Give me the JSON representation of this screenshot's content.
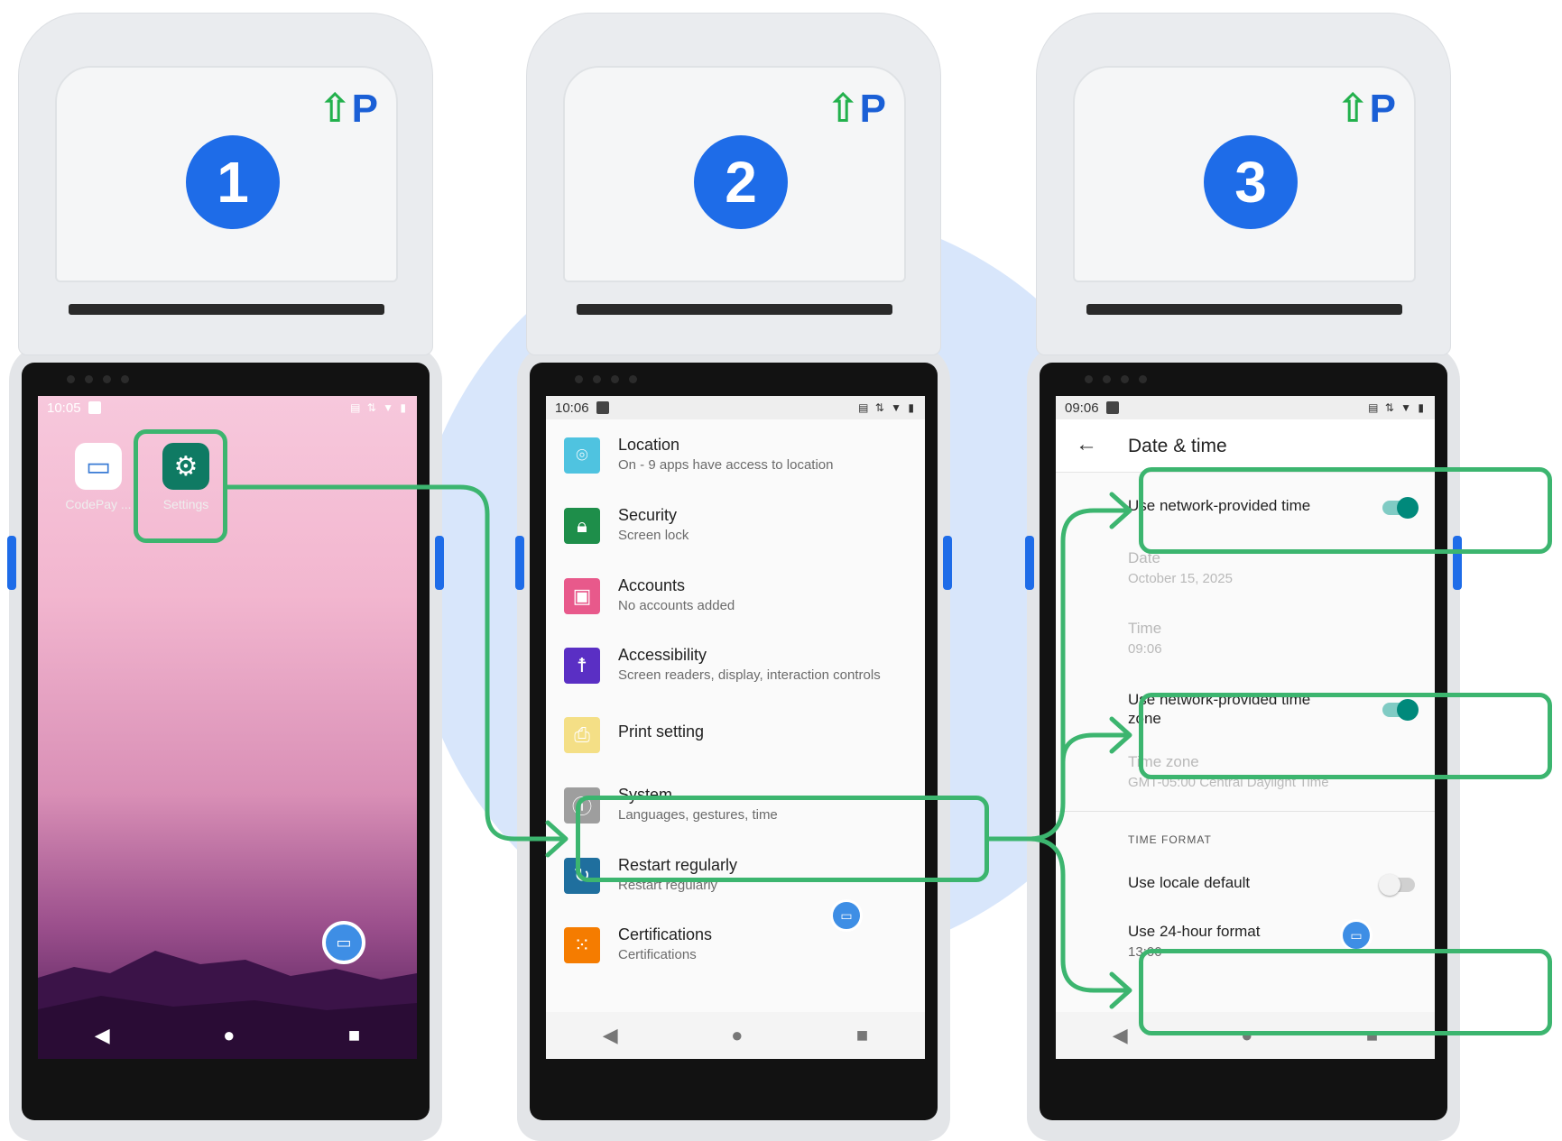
{
  "brand": {
    "logo_text": "P",
    "logo_mark": "up-arrow-tree"
  },
  "steps": [
    "1",
    "2",
    "3"
  ],
  "phone1": {
    "time": "10:05",
    "apps": [
      {
        "label": "CodePay ...",
        "icon": "card-icon"
      },
      {
        "label": "Settings",
        "icon": "gear-icon"
      }
    ]
  },
  "phone2": {
    "time": "10:06",
    "settings": [
      {
        "title": "Location",
        "subtitle": "On - 9 apps have access to location",
        "icon": "location-pin-icon",
        "color": "#4fc3e0"
      },
      {
        "title": "Security",
        "subtitle": "Screen lock",
        "icon": "lock-icon",
        "color": "#1e8e4a"
      },
      {
        "title": "Accounts",
        "subtitle": "No accounts added",
        "icon": "account-icon",
        "color": "#e8598b"
      },
      {
        "title": "Accessibility",
        "subtitle": "Screen readers, display, interaction controls",
        "icon": "accessibility-icon",
        "color": "#5a2fc4"
      },
      {
        "title": "Print setting",
        "subtitle": "",
        "icon": "print-icon",
        "color": "#f4df86"
      },
      {
        "title": "System",
        "subtitle": "Languages, gestures, time",
        "icon": "info-icon",
        "color": "#9e9e9e"
      },
      {
        "title": "Restart regularly",
        "subtitle": "Restart regularly",
        "icon": "restart-icon",
        "color": "#1f6f9e"
      },
      {
        "title": "Certifications",
        "subtitle": "Certifications",
        "icon": "grid-icon",
        "color": "#f57c00"
      }
    ]
  },
  "phone3": {
    "time": "09:06",
    "title": "Date & time",
    "rows": {
      "network_time": "Use network-provided time",
      "date_label": "Date",
      "date_value": "October 15, 2025",
      "time_label": "Time",
      "time_value": "09:06",
      "network_zone": "Use network-provided time zone",
      "zone_label": "Time zone",
      "zone_value": "GMT-05:00 Central Daylight Time",
      "section": "TIME FORMAT",
      "locale_default": "Use locale default",
      "format_24": "Use 24-hour format",
      "format_24_sub": "13:00"
    },
    "toggles": {
      "network_time": true,
      "network_zone": true,
      "locale_default": false
    }
  },
  "colors": {
    "highlight": "#3cb56f",
    "step_badge": "#1e6ce8",
    "accent": "#00897b"
  }
}
